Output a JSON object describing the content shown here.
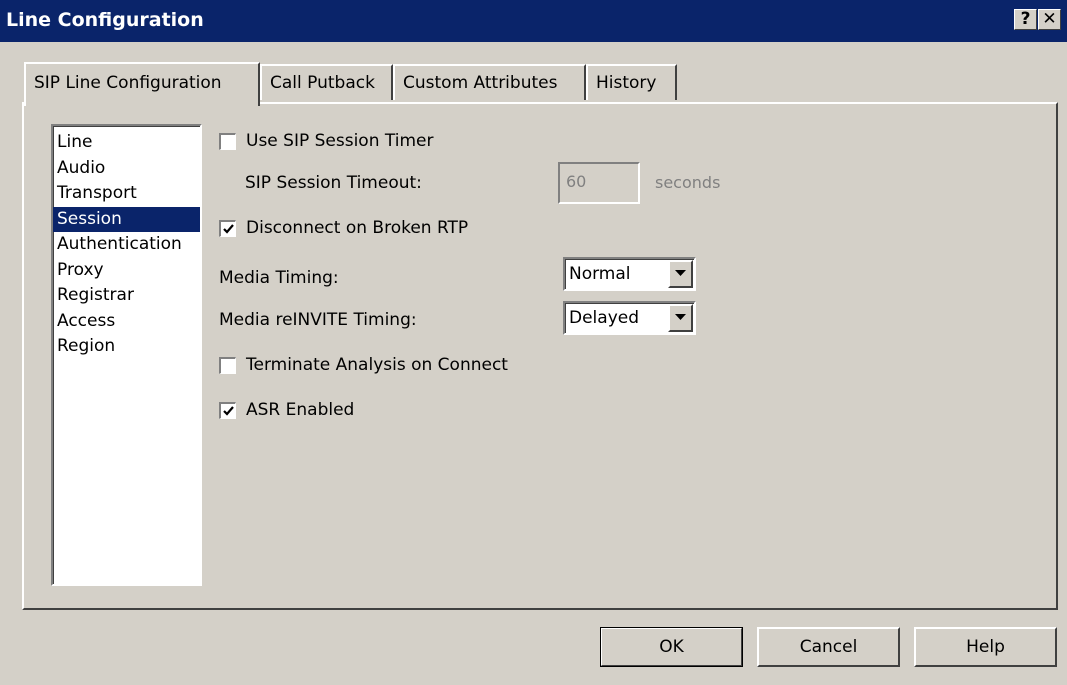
{
  "window": {
    "title": "Line Configuration",
    "help_glyph": "?",
    "close_glyph": "✕"
  },
  "tabs": [
    {
      "label": "SIP Line Configuration",
      "active": true
    },
    {
      "label": "Call Putback",
      "active": false
    },
    {
      "label": "Custom Attributes",
      "active": false
    },
    {
      "label": "History",
      "active": false
    }
  ],
  "sidebar": {
    "items": [
      {
        "label": "Line"
      },
      {
        "label": "Audio"
      },
      {
        "label": "Transport"
      },
      {
        "label": "Session",
        "selected": true
      },
      {
        "label": "Authentication"
      },
      {
        "label": "Proxy"
      },
      {
        "label": "Registrar"
      },
      {
        "label": "Access"
      },
      {
        "label": "Region"
      }
    ]
  },
  "session": {
    "use_sip_session_timer": {
      "label": "Use SIP Session Timer",
      "checked": false
    },
    "sip_session_timeout": {
      "label": "SIP Session Timeout:",
      "value": "60",
      "unit": "seconds",
      "disabled": true
    },
    "disconnect_on_broken_rtp": {
      "label": "Disconnect on Broken RTP",
      "checked": true
    },
    "media_timing": {
      "label": "Media Timing:",
      "value": "Normal"
    },
    "media_reinvite_timing": {
      "label": "Media reINVITE Timing:",
      "value": "Delayed"
    },
    "terminate_analysis_on_connect": {
      "label": "Terminate Analysis on Connect",
      "checked": false
    },
    "asr_enabled": {
      "label": "ASR Enabled",
      "checked": true
    }
  },
  "buttons": {
    "ok": "OK",
    "cancel": "Cancel",
    "help": "Help"
  },
  "colors": {
    "titlebar": "#0a246a",
    "face": "#d4d0c8",
    "selection": "#0a246a"
  }
}
